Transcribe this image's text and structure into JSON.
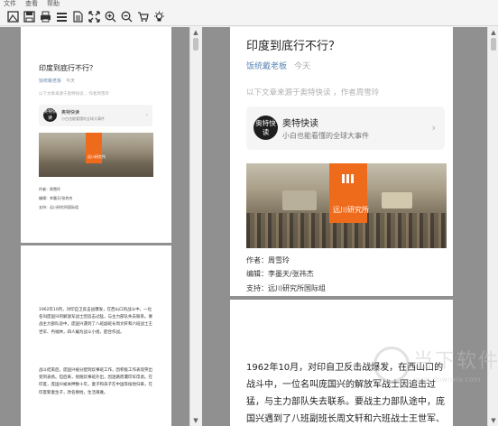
{
  "menu": [
    "文件",
    "查看",
    "帮助"
  ],
  "toolbar_icons": [
    "image-icon",
    "save-icon",
    "print-icon",
    "page-layout-icon",
    "document-icon",
    "fit-page-icon",
    "zoom-in-icon",
    "zoom-out-icon",
    "cart-icon",
    "bulb-icon"
  ],
  "article": {
    "title": "印度到底行不行？",
    "source": "饭统戴老板",
    "time": "今天",
    "intro": "以下文章来源于奥特快读 ，作者周雪玲",
    "card": {
      "logo": "奥特快读",
      "name": "奥特快读",
      "desc": "小白也能看懂的全球大事件"
    },
    "photo_label": "远川研究所",
    "credits": [
      "作者：周雪玲",
      "编辑：李墨天/张祎杰",
      "支持：远川研究所国际组"
    ],
    "thumb_credits": [
      "作者：周雪玲",
      "编辑：李墨天/张祎杰",
      "支持：远川研究所国际组"
    ],
    "body_page2": "1962年10月，对印自卫反击战爆发，在西山口的战斗中，一位名叫庞国兴的解放军战士因追击过猛，与主力部队失去联系。要战主力部队途中，庞国兴遇到了八班副班长周文轩和六班战士王世军、冉福林，四"
  },
  "thumb2": {
    "para1": "1962年10月，对印自卫反击战爆发，在西山口的战斗中，一位名叫庞国兴的解放军战士因追击过猛，与主力部队失去联系。要战主力部队途中，庞国兴遇到了八班副班长周文轩和六班战士王世军、冉福林，四人编为战斗小组，配合作战。",
    "para2": "战斗结束后，庞国兴被分配到炊事班工作，因积极工作表现突出受到表扬。但后来，他随炊事班外出，因迷路而遭印军俘虏。在印度，庞国兴被关押数十年，妻子和孩子在中国等候他归来，在印度娶妻生子，改名换姓，生活艰难。"
  },
  "watermark": {
    "text": "当下软件",
    "sub": "www.downxia.com"
  }
}
